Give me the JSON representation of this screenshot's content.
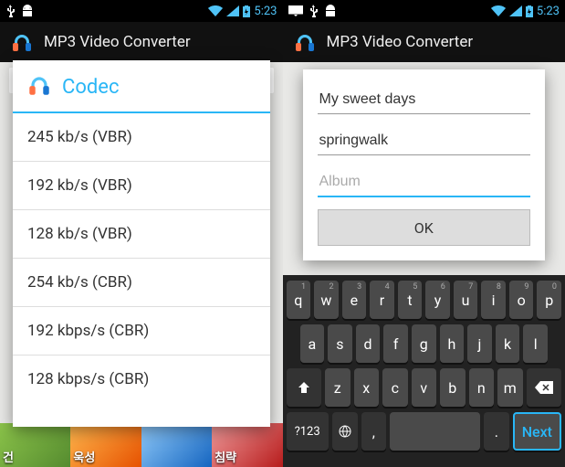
{
  "status": {
    "time": "5:23"
  },
  "app": {
    "title": "MP3 Video Converter"
  },
  "left": {
    "backdrop_path": "/storage/sdcard0/DCIM/",
    "dialog_title": "Codec",
    "codec_options": [
      "245 kb/s (VBR)",
      "192  kb/s (VBR)",
      "128  kb/s (VBR)",
      "254 kb/s (CBR)",
      "192 kbps/s (CBR)",
      "128 kbps/s (CBR)"
    ],
    "ads": [
      "건",
      "욱성",
      "",
      "침략"
    ]
  },
  "right": {
    "fields": {
      "title_value": "My sweet days",
      "artist_value": "springwalk",
      "album_value": "",
      "album_placeholder": "Album"
    },
    "ok": "OK",
    "keyboard": {
      "row1": [
        "q",
        "w",
        "e",
        "r",
        "t",
        "y",
        "u",
        "i",
        "o",
        "p"
      ],
      "row2": [
        "a",
        "s",
        "d",
        "f",
        "g",
        "h",
        "j",
        "k",
        "l"
      ],
      "row3": [
        "z",
        "x",
        "c",
        "v",
        "b",
        "n",
        "m"
      ],
      "sym": "?123",
      "comma": ",",
      "period": ".",
      "next": "Next"
    }
  }
}
